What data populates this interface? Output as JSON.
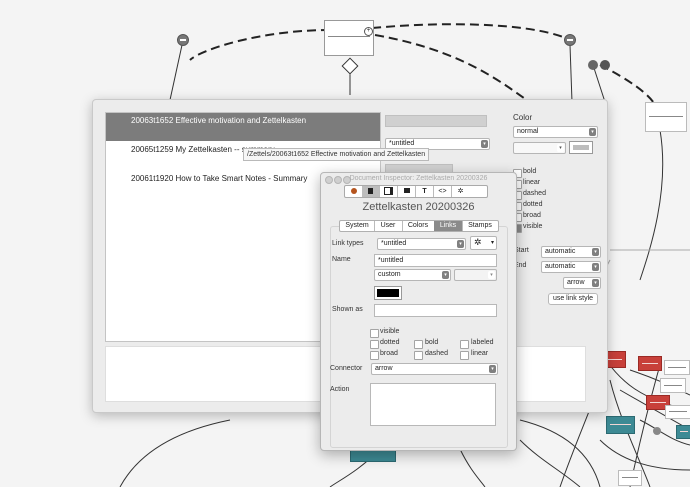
{
  "popover": {
    "notes": [
      "20063t1652 Effective motivation and Zettelkasten",
      "20065t1259 My Zettelkasten -- summary",
      "20061t1920 How to Take Smart Notes - Summary"
    ],
    "tooltip": "/Zettels/20063t1652 Effective motivation and Zettelkasten",
    "untitled_value": "*untitled",
    "color_label": "Color",
    "color_value": "normal",
    "styles": [
      "bold",
      "linear",
      "dashed",
      "dotted",
      "broad",
      "visible"
    ],
    "start_label": "Start",
    "start_value": "automatic",
    "end_label": "End",
    "end_value": "automatic",
    "arrow_value": "arrow",
    "use_link_style": "use link style"
  },
  "inspector": {
    "window_title": "Document Inspector: Zettelkasten 20200326",
    "toolbar_icons": [
      "bomb-icon",
      "document-icon",
      "page-corner-icon",
      "window-icon",
      "text-icon",
      "code-icon",
      "gear-icon"
    ],
    "toolbar_glyphs": [
      "",
      "",
      "",
      "",
      "T",
      "<>",
      "✲"
    ],
    "doc_name": "Zettelkasten 20200326",
    "tabs": [
      "System",
      "User",
      "Colors",
      "Links",
      "Stamps"
    ],
    "active_tab": "Links",
    "link_types_label": "Link types",
    "link_types_value": "*untitled",
    "name_label": "Name",
    "name_value": "*untitled",
    "style_value": "custom",
    "shown_as_label": "Shown as",
    "checkboxes": {
      "visible": "visible",
      "dotted": "dotted",
      "bold": "bold",
      "labeled": "labeled",
      "broad": "broad",
      "dashed": "dashed",
      "linear": "linear"
    },
    "connector_label": "Connector",
    "connector_value": "arrow",
    "action_label": "Action",
    "color_swatch": "#000000"
  },
  "colors": {
    "selected_row": "#7c7c7c",
    "node_red": "#c8403a",
    "node_teal": "#3d8a94"
  }
}
